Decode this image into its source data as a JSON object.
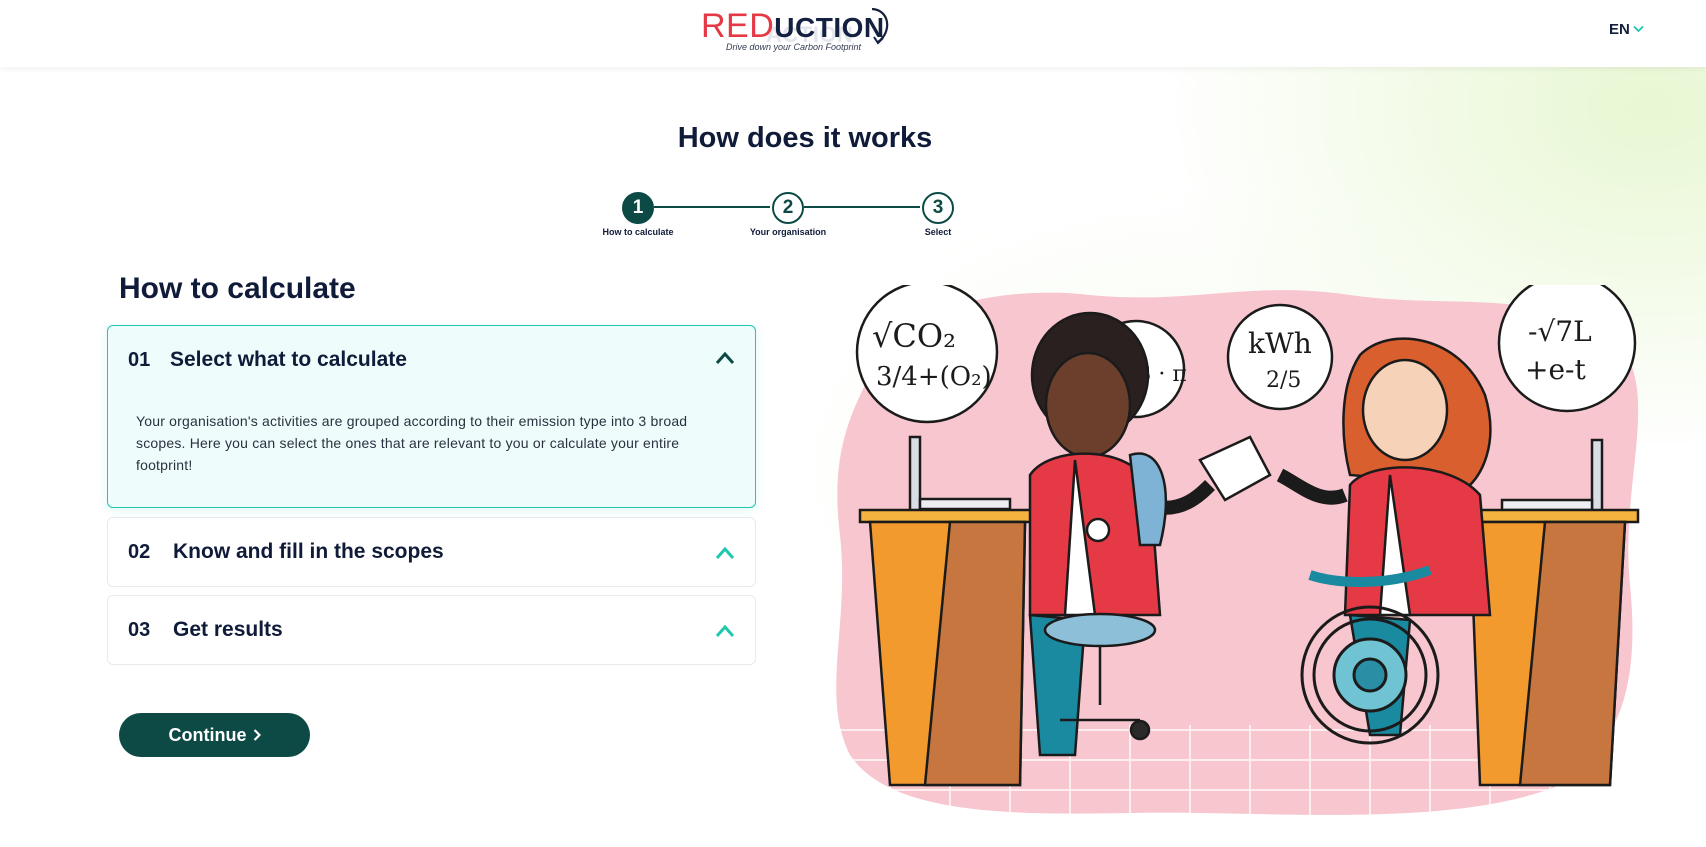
{
  "header": {
    "logo": {
      "red_text": "RED",
      "dark_text": "UCTION",
      "ghost_text": "ACTION",
      "tagline": "Drive down your Carbon Footprint"
    },
    "language": {
      "label": "EN"
    }
  },
  "page_title": "How does it works",
  "stepper": {
    "steps": [
      {
        "number": "1",
        "label": "How to calculate",
        "active": true
      },
      {
        "number": "2",
        "label": "Your organisation",
        "active": false
      },
      {
        "number": "3",
        "label": "Select",
        "active": false
      }
    ]
  },
  "section_title": "How to calculate",
  "accordion": [
    {
      "number": "01",
      "title": "Select what to calculate",
      "expanded": true,
      "body": "Your organisation's activities are grouped according to their emission type into 3 broad scopes. Here you can select the ones that are relevant to you or calculate your entire footprint!"
    },
    {
      "number": "02",
      "title": "Know and fill in the scopes",
      "expanded": false
    },
    {
      "number": "03",
      "title": "Get results",
      "expanded": false
    }
  ],
  "continue_label": "Continue",
  "illustration": {
    "bubbles": [
      "√CO₂",
      "3/4+(O₂)",
      "1/√3 · π",
      "kWh",
      "2/5",
      "-√7L",
      "+e-t"
    ]
  },
  "colors": {
    "accent": "#0d4a45",
    "teal": "#1ec7ad",
    "brand_red": "#e63946",
    "text": "#101b3a"
  }
}
